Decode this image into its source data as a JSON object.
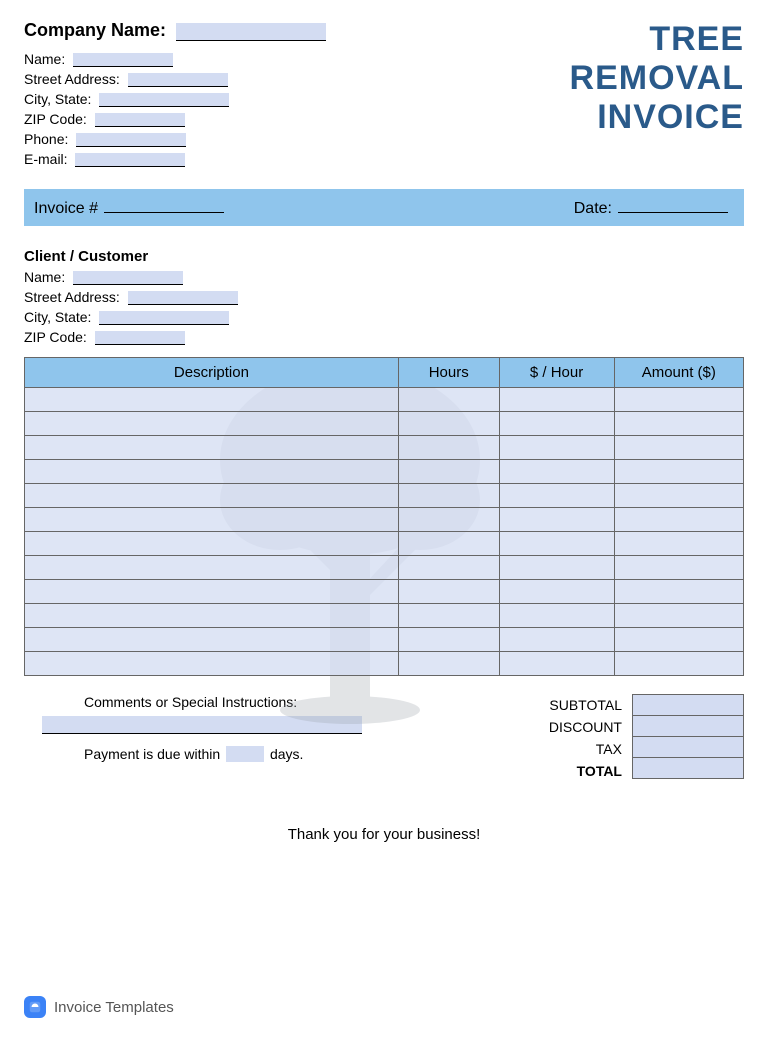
{
  "header": {
    "company_name_label": "Company Name:",
    "name_label": "Name:",
    "street_label": "Street Address:",
    "city_state_label": "City, State:",
    "zip_label": "ZIP Code:",
    "phone_label": "Phone:",
    "email_label": "E-mail:",
    "title_line1": "TREE",
    "title_line2": "REMOVAL",
    "title_line3": "INVOICE"
  },
  "invoice_bar": {
    "invoice_label": "Invoice #",
    "date_label": "Date:"
  },
  "client": {
    "heading": "Client / Customer",
    "name_label": "Name:",
    "street_label": "Street Address:",
    "city_state_label": "City, State:",
    "zip_label": "ZIP Code:"
  },
  "table": {
    "col_description": "Description",
    "col_hours": "Hours",
    "col_rate": "$ / Hour",
    "col_amount": "Amount ($)",
    "row_count": 12
  },
  "comments": {
    "label": "Comments or Special Instructions:",
    "due_prefix": "Payment is due within",
    "due_suffix": "days."
  },
  "totals": {
    "subtotal": "SUBTOTAL",
    "discount": "DISCOUNT",
    "tax": "TAX",
    "total": "TOTAL"
  },
  "thankyou": "Thank you for your business!",
  "footer": {
    "brand": "Invoice Templates"
  }
}
